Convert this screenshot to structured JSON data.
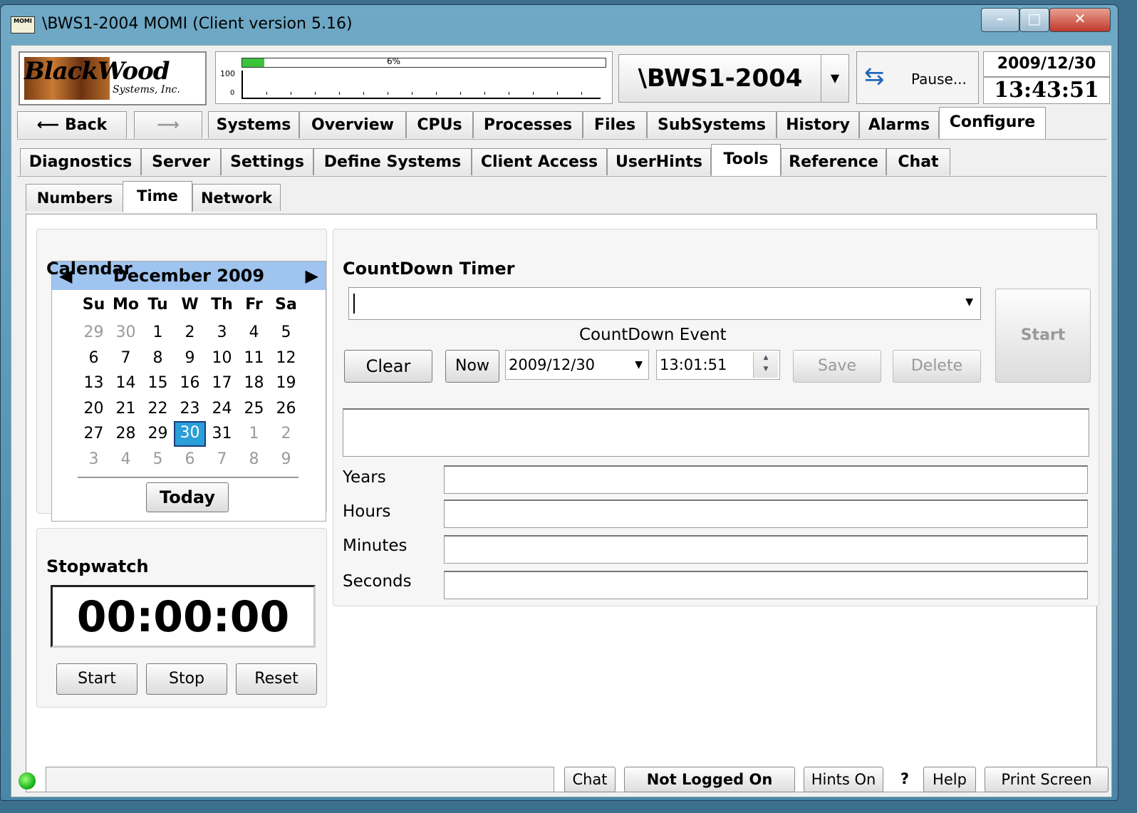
{
  "window": {
    "title": "\\BWS1-2004 MOMI (Client version 5.16)",
    "icon_text": "MOMI"
  },
  "logo": {
    "main": "BlackWood",
    "sub": "Systems, Inc."
  },
  "gauge": {
    "percent_label": "6%",
    "percent": 6,
    "max_label": "100",
    "min_label": "0"
  },
  "system": {
    "name": "\\BWS1-2004"
  },
  "pause": {
    "label": "Pause..."
  },
  "clock": {
    "date": "2009/12/30",
    "time": "13:43:51"
  },
  "nav": {
    "back": "Back",
    "tabs": [
      "Systems",
      "Overview",
      "CPUs",
      "Processes",
      "Files",
      "SubSystems",
      "History",
      "Alarms",
      "Configure"
    ],
    "active": "Configure"
  },
  "configure_tabs": [
    "Diagnostics",
    "Server",
    "Settings",
    "Define Systems",
    "Client Access",
    "UserHints",
    "Tools",
    "Reference",
    "Chat"
  ],
  "tools_tabs": [
    "Numbers",
    "Time",
    "Network"
  ],
  "calendar": {
    "title": "Calendar",
    "month": "December 2009",
    "dow": [
      "Su",
      "Mo",
      "Tu",
      "W",
      "Th",
      "Fr",
      "Sa"
    ],
    "weeks": [
      [
        "29",
        "30",
        "1",
        "2",
        "3",
        "4",
        "5"
      ],
      [
        "6",
        "7",
        "8",
        "9",
        "10",
        "11",
        "12"
      ],
      [
        "13",
        "14",
        "15",
        "16",
        "17",
        "18",
        "19"
      ],
      [
        "20",
        "21",
        "22",
        "23",
        "24",
        "25",
        "26"
      ],
      [
        "27",
        "28",
        "29",
        "30",
        "31",
        "1",
        "2"
      ],
      [
        "3",
        "4",
        "5",
        "6",
        "7",
        "8",
        "9"
      ]
    ],
    "today_button": "Today"
  },
  "stopwatch": {
    "title": "Stopwatch",
    "display": "00:00:00",
    "start": "Start",
    "stop": "Stop",
    "reset": "Reset"
  },
  "countdown": {
    "title": "CountDown Timer",
    "event_label": "CountDown Event",
    "clear": "Clear",
    "now": "Now",
    "date": "2009/12/30",
    "time": "13:01:51",
    "save": "Save",
    "delete": "Delete",
    "start": "Start",
    "years": "Years",
    "hours": "Hours",
    "minutes": "Minutes",
    "seconds": "Seconds"
  },
  "statusbar": {
    "chat": "Chat",
    "login": "Not Logged On",
    "hints": "Hints On",
    "question": "?",
    "help": "Help",
    "print": "Print Screen"
  }
}
